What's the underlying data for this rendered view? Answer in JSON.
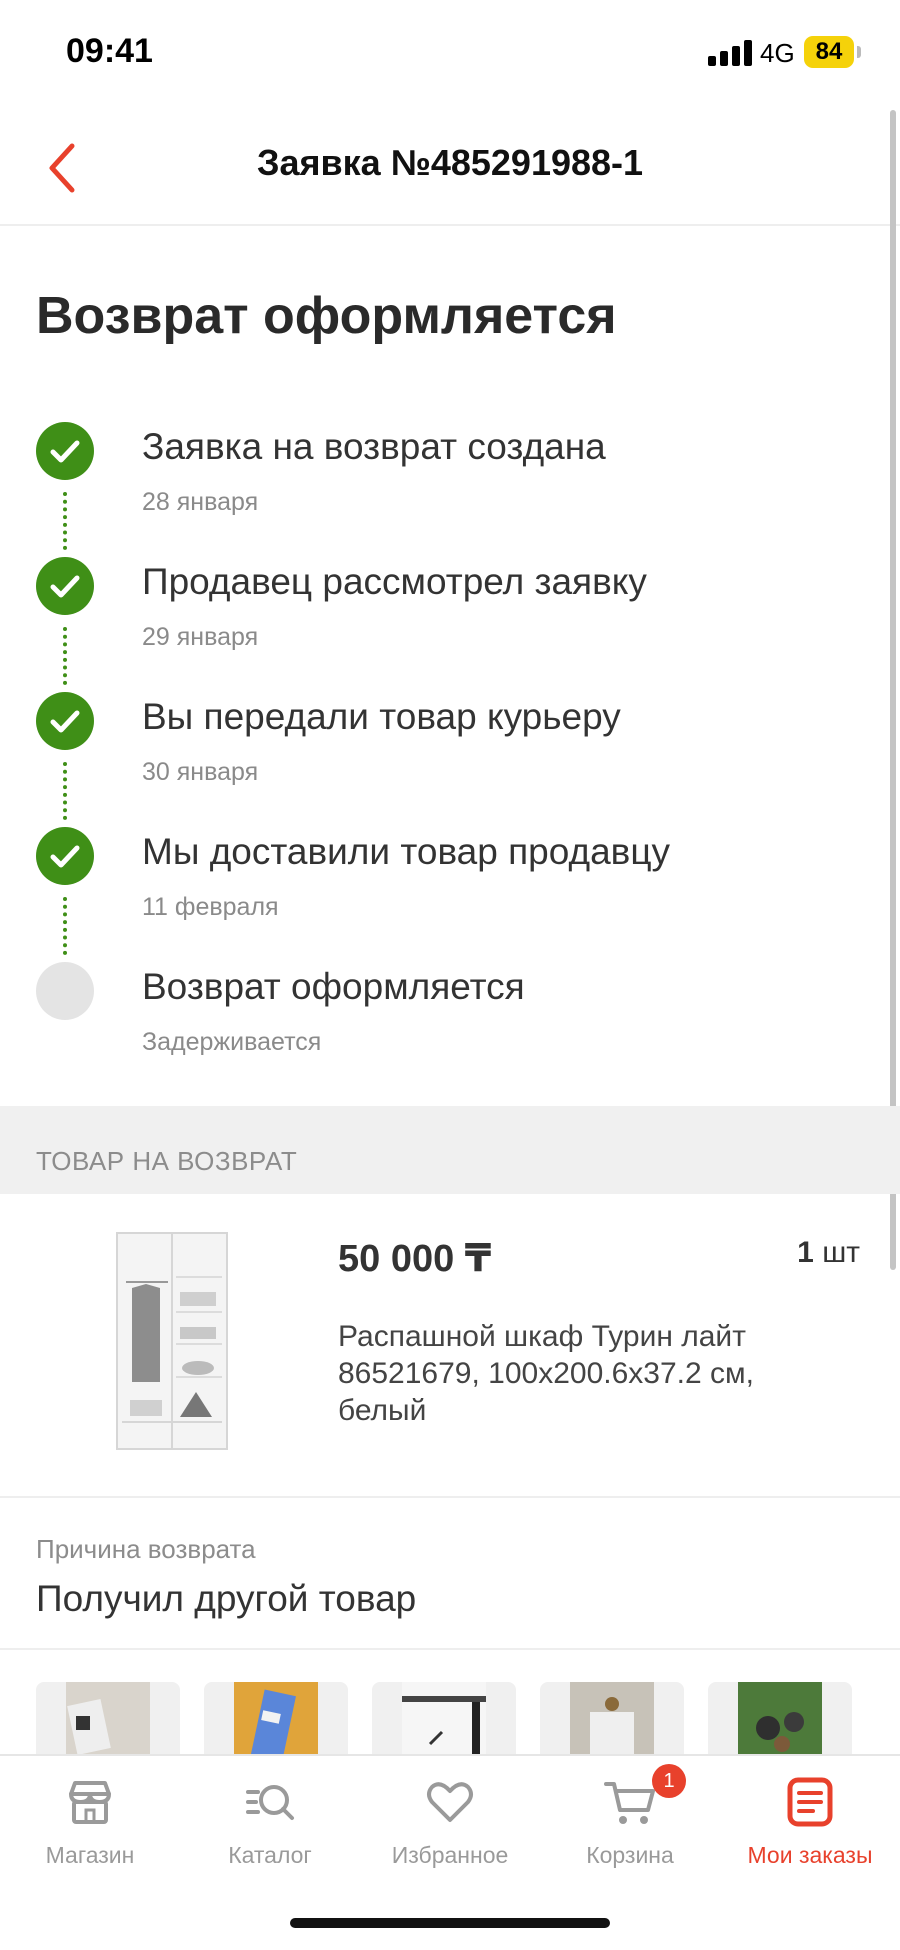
{
  "status_bar": {
    "time": "09:41",
    "network": "4G",
    "battery": "84"
  },
  "header": {
    "title": "Заявка №485291988-1"
  },
  "status": {
    "title": "Возврат оформляется",
    "steps": [
      {
        "label": "Заявка на возврат создана",
        "date": "28 января",
        "done": true
      },
      {
        "label": "Продавец рассмотрел заявку",
        "date": "29 января",
        "done": true
      },
      {
        "label": "Вы передали товар курьеру",
        "date": "30 января",
        "done": true
      },
      {
        "label": "Мы доставили товар продавцу",
        "date": "11 февраля",
        "done": true
      },
      {
        "label": "Возврат оформляется",
        "date": "Задерживается",
        "done": false
      }
    ]
  },
  "return_section": {
    "title": "ТОВАР НА ВОЗВРАТ"
  },
  "product": {
    "price": "50 000 ₸",
    "qty": "1",
    "qty_unit": "шт",
    "name": "Распашной шкаф Турин лайт 86521679, 100x200.6x37.2 см, белый"
  },
  "reason": {
    "label": "Причина возврата",
    "value": "Получил другой товар"
  },
  "tabbar": {
    "items": [
      {
        "label": "Магазин",
        "icon": "store-icon"
      },
      {
        "label": "Каталог",
        "icon": "catalog-search-icon"
      },
      {
        "label": "Избранное",
        "icon": "heart-icon"
      },
      {
        "label": "Корзина",
        "icon": "cart-icon",
        "badge": "1"
      },
      {
        "label": "Мои заказы",
        "icon": "orders-icon",
        "active": true
      }
    ]
  },
  "colors": {
    "accent": "#e8412c",
    "success": "#3f8f17",
    "muted": "#8c8c8c"
  }
}
